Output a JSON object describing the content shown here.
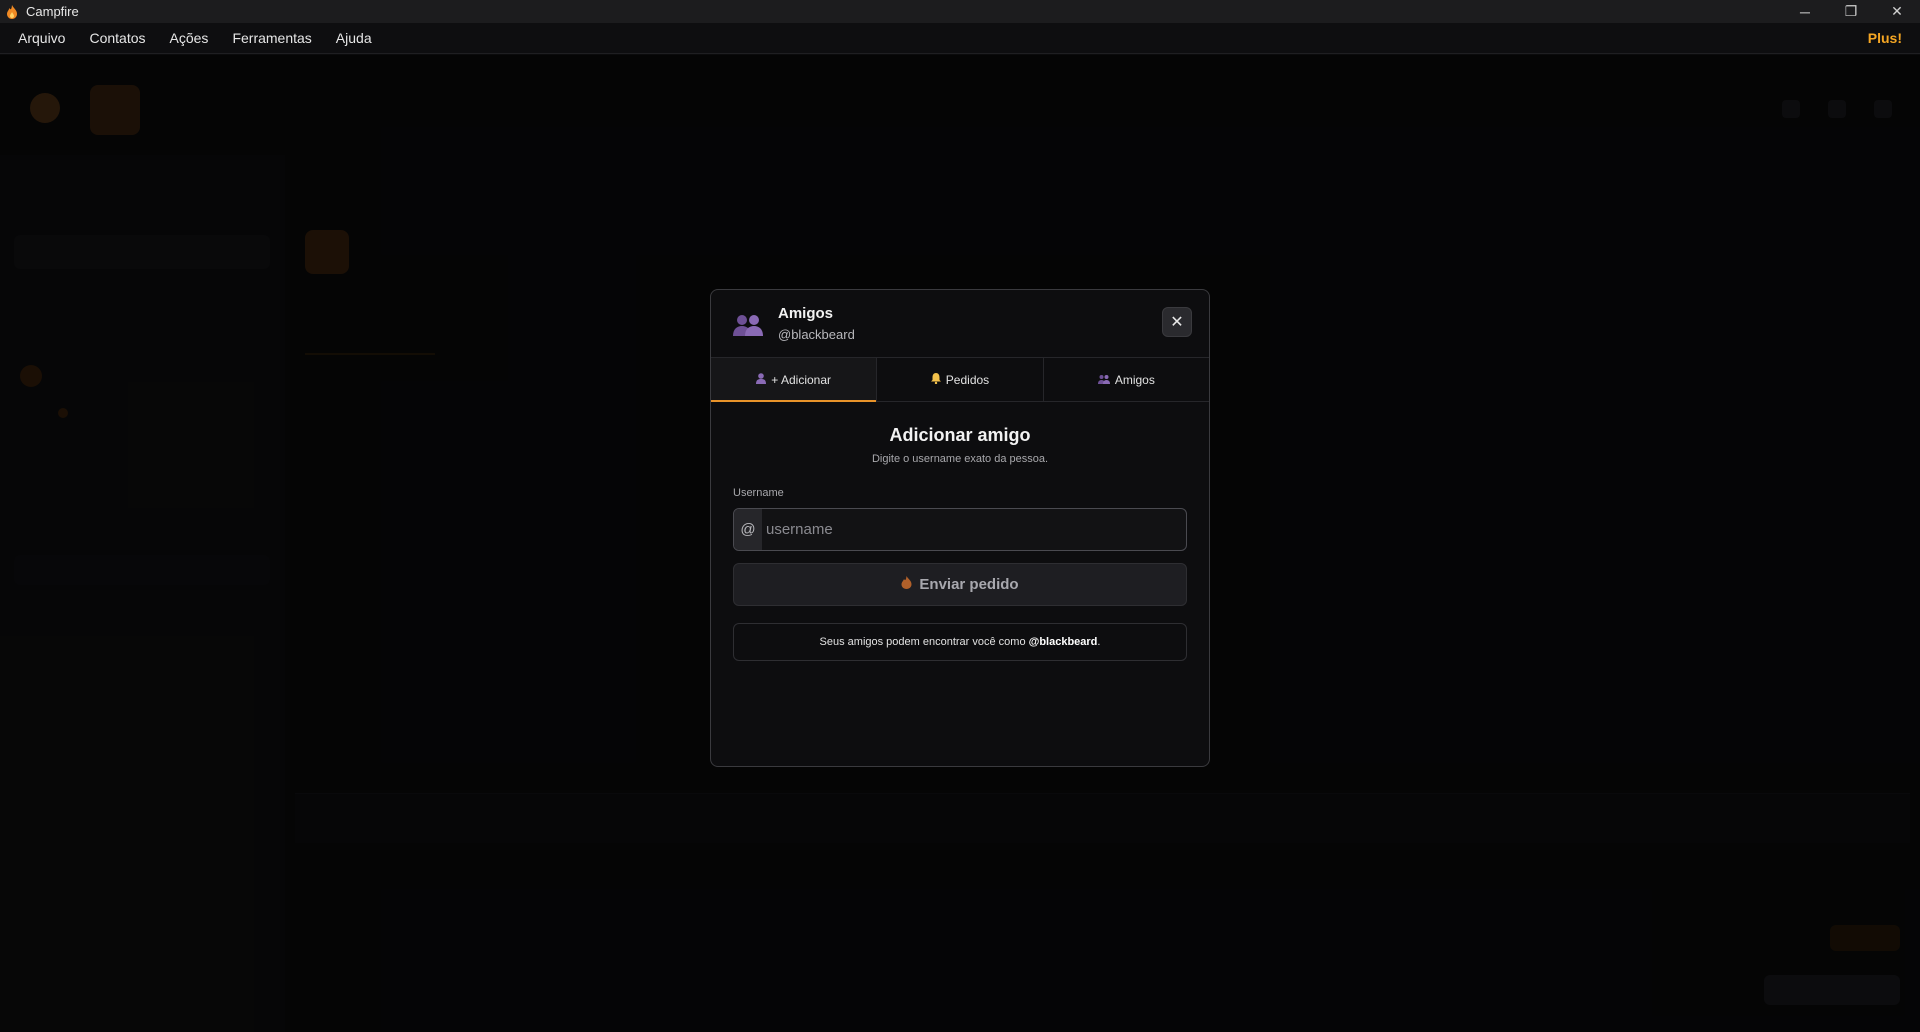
{
  "window": {
    "title": "Campfire",
    "controls": {
      "minimize": "─",
      "restore": "❐",
      "close": "✕"
    }
  },
  "menubar": {
    "items": [
      "Arquivo",
      "Contatos",
      "Ações",
      "Ferramentas",
      "Ajuda"
    ],
    "plus_label": "Plus!"
  },
  "modal": {
    "title": "Amigos",
    "subtitle": "@blackbeard",
    "close_glyph": "✕",
    "tabs": [
      {
        "label": "+ Adicionar",
        "icon": "user-icon",
        "active": true
      },
      {
        "label": "Pedidos",
        "icon": "bell-icon",
        "active": false
      },
      {
        "label": "Amigos",
        "icon": "users-icon",
        "active": false
      }
    ],
    "form": {
      "title": "Adicionar amigo",
      "description": "Digite o username exato da pessoa.",
      "field_label": "Username",
      "prefix": "@",
      "placeholder": "username",
      "value": "",
      "button_label": "Enviar pedido"
    },
    "info": {
      "text": "Seus amigos podem encontrar você como",
      "handle": "@blackbeard",
      "suffix": "."
    }
  },
  "colors": {
    "accent": "#e8932a",
    "plus": "#f5a623",
    "users_icon": "#7a5aa0"
  }
}
